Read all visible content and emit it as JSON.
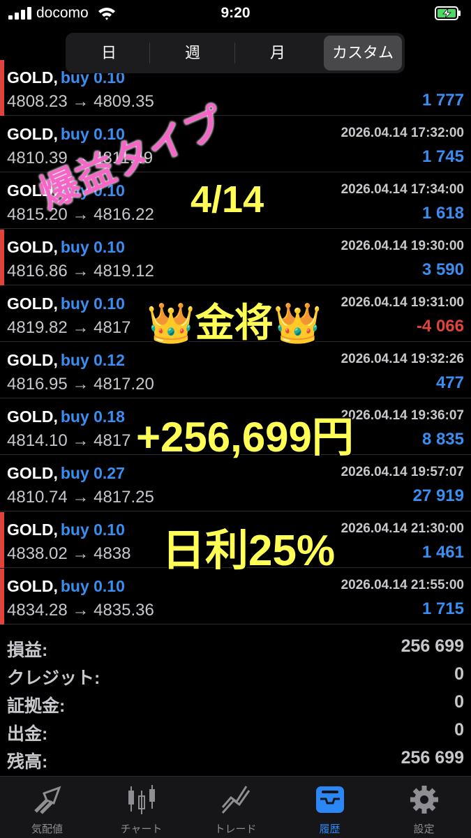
{
  "status": {
    "carrier": "docomo",
    "time": "9:20"
  },
  "segments": [
    {
      "label": "日",
      "active": false
    },
    {
      "label": "週",
      "active": false
    },
    {
      "label": "月",
      "active": false
    },
    {
      "label": "カスタム",
      "active": true
    }
  ],
  "trades": [
    {
      "symbol": "GOLD,",
      "type": "buy 0.10",
      "prices": "4808.23 → 4809.35",
      "date": "",
      "profit": "1 777",
      "negative": false,
      "marker": true
    },
    {
      "symbol": "GOLD,",
      "type": "buy 0.10",
      "prices": "4810.39 → 4811.49",
      "date": "2026.04.14 17:32:00",
      "profit": "1 745",
      "negative": false,
      "marker": false
    },
    {
      "symbol": "GOLD,",
      "type": "buy 0.10",
      "prices": "4815.20 → 4816.22",
      "date": "2026.04.14 17:34:00",
      "profit": "1 618",
      "negative": false,
      "marker": false
    },
    {
      "symbol": "GOLD,",
      "type": "buy 0.10",
      "prices": "4816.86 → 4819.12",
      "date": "2026.04.14 19:30:00",
      "profit": "3 590",
      "negative": false,
      "marker": true
    },
    {
      "symbol": "GOLD,",
      "type": "buy 0.10",
      "prices": "4819.82 → 4817",
      "date": "2026.04.14 19:31:00",
      "profit": "-4 066",
      "negative": true,
      "marker": false
    },
    {
      "symbol": "GOLD,",
      "type": "buy 0.12",
      "prices": "4816.95 → 4817.20",
      "date": "2026.04.14 19:32:26",
      "profit": "477",
      "negative": false,
      "marker": false
    },
    {
      "symbol": "GOLD,",
      "type": "buy 0.18",
      "prices": "4814.10 → 4817",
      "date": "2026.04.14 19:36:07",
      "profit": "8 835",
      "negative": false,
      "marker": false
    },
    {
      "symbol": "GOLD,",
      "type": "buy 0.27",
      "prices": "4810.74 → 4817.25",
      "date": "2026.04.14 19:57:07",
      "profit": "27 919",
      "negative": false,
      "marker": false
    },
    {
      "symbol": "GOLD,",
      "type": "buy 0.10",
      "prices": "4838.02 → 4838",
      "date": "2026.04.14 21:30:00",
      "profit": "1 461",
      "negative": false,
      "marker": true
    },
    {
      "symbol": "GOLD,",
      "type": "buy 0.10",
      "prices": "4834.28 → 4835.36",
      "date": "2026.04.14 21:55:00",
      "profit": "1 715",
      "negative": false,
      "marker": true
    }
  ],
  "summary": [
    {
      "label": "損益:",
      "value": "256 699"
    },
    {
      "label": "クレジット:",
      "value": "0"
    },
    {
      "label": "証拠金:",
      "value": "0"
    },
    {
      "label": "出金:",
      "value": "0"
    },
    {
      "label": "残高:",
      "value": "256 699"
    }
  ],
  "tabs": [
    {
      "label": "気配値",
      "icon": "quotes-arrows-icon",
      "active": false
    },
    {
      "label": "チャート",
      "icon": "candlestick-chart-icon",
      "active": false
    },
    {
      "label": "トレード",
      "icon": "trade-line-icon",
      "active": false
    },
    {
      "label": "履歴",
      "icon": "history-inbox-icon",
      "active": true
    },
    {
      "label": "設定",
      "icon": "gear-icon",
      "active": false
    }
  ],
  "overlay": {
    "title": "爆益タイプ",
    "date": "4/14",
    "name": "👑金将👑",
    "profit": "+256,699円",
    "daily_rate": "日利25%"
  },
  "colors": {
    "accent_blue": "#3b8df0",
    "loss_red": "#e0443a",
    "overlay_pink": "#f566c6",
    "overlay_yellow": "#ffff55",
    "battery_green": "#4cd964"
  }
}
